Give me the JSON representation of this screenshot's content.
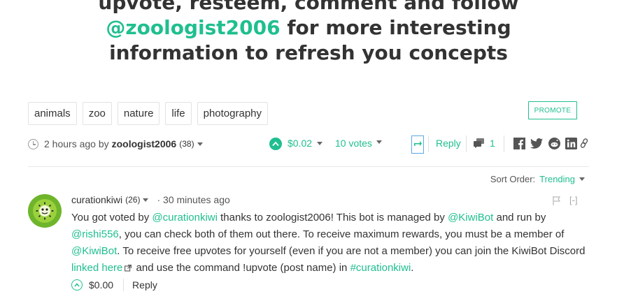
{
  "headline": {
    "line1": "upvote, resteem, comment and follow",
    "line2_mention": "@zoologist2006",
    "line2_rest": " for more interesting",
    "line3": "information to refresh you concepts"
  },
  "tags": [
    "animals",
    "zoo",
    "nature",
    "life",
    "photography"
  ],
  "promote_label": "PROMOTE",
  "post_meta": {
    "time": "2 hours ago by",
    "author": "zoologist2006",
    "reputation": "(38)",
    "payout": "$0.02",
    "votes": "10 votes",
    "reply_label": "Reply",
    "comment_count": "1"
  },
  "sort": {
    "label": "Sort Order:",
    "value": "Trending"
  },
  "comment": {
    "author": "curationkiwi",
    "reputation": "(26)",
    "time": "· 30 minutes ago",
    "collapse": "[-]",
    "line1_a": "You got voted by ",
    "line1_m1": "@curationkiwi",
    "line1_b": " thanks to zoologist2006! This bot is managed by ",
    "line1_m2": "@KiwiBot",
    "line1_c": " and run by",
    "line2_m": "@rishi556",
    "line2_b": ", you can check both of them out there. To receive maximum rewards, you must be a member of",
    "line3_m": "@KiwiBot",
    "line3_b": ". To receive free upvotes for yourself (even if you are not a member) you can join the KiwiBot Discord",
    "line4_link": "linked here",
    "line4_b": " and use the command !upvote (post name) in ",
    "line4_tag": "#curationkiwi",
    "line4_c": ".",
    "payout": "$0.00",
    "reply_label": "Reply"
  },
  "colors": {
    "accent": "#1fbf8f",
    "text": "#333333",
    "border": "#e2e2e2"
  }
}
